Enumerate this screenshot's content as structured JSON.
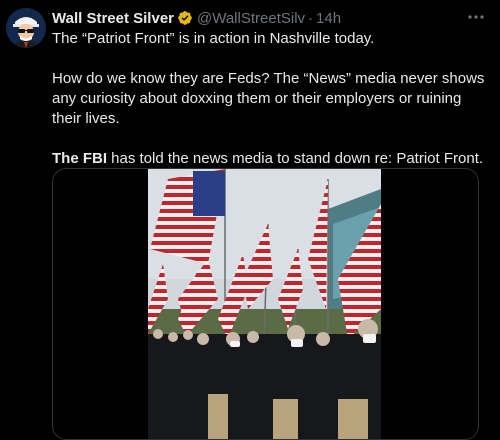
{
  "author": {
    "name": "Wall Street Silver",
    "handle": "@WallStreetSilv",
    "separator": "·",
    "time": "14h"
  },
  "icons": {
    "avatar": "avatar-icon",
    "badge": "verified-badge-icon",
    "more": "more-options-icon"
  },
  "colors": {
    "background": "#000000",
    "text": "#e7e9ea",
    "muted": "#71767b",
    "badge": "#e2b719",
    "border": "#2f3336"
  },
  "tweet": {
    "line1": "The “Patriot Front” is in action in Nashville today.",
    "line2": "How do we know they are Feds? The “News” media never shows any curiosity about doxxing them or their employers or ruining their lives.",
    "line3_bold": "The FBI",
    "line3_rest": " has told the news media to stand down re: Patriot Front."
  }
}
